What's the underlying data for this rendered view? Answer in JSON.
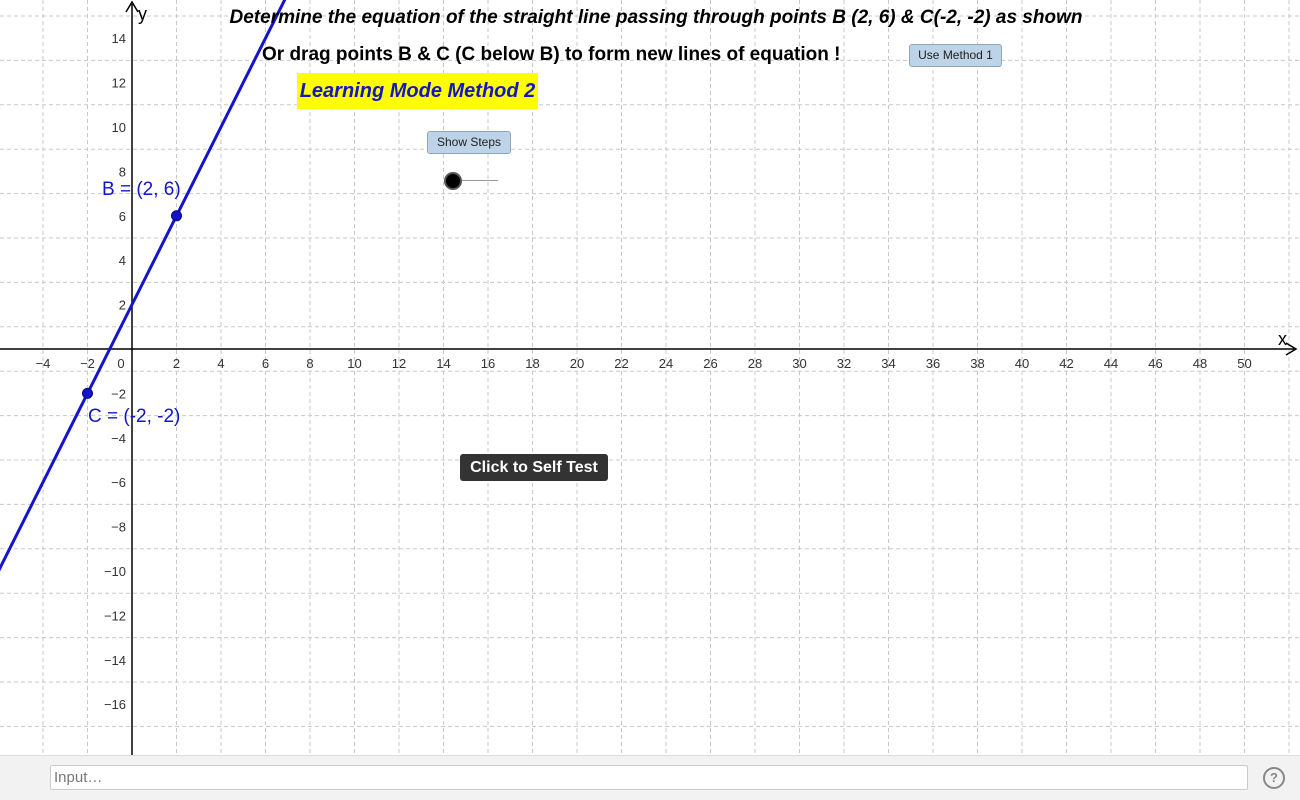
{
  "toolbar": {
    "heading": "Determine the equation of the straight line passing through points B (2, 6) & C(-2, -2) as shown",
    "instruction": "Or drag points B & C  (C below B)  to form new lines of equation !",
    "mode_label": "Learning Mode Method 2",
    "method_button": "Use Method 1",
    "steps_button": "Show Steps",
    "self_test_button": "Click to Self Test"
  },
  "points": {
    "B": {
      "label": "B = (2, 6)",
      "x": 2,
      "y": 6
    },
    "C": {
      "label": "C = (-2, -2)",
      "x": -2,
      "y": -2
    }
  },
  "slider": {
    "value": 0
  },
  "axes": {
    "x_label": "x",
    "y_label": "y",
    "x_ticks": [
      -4,
      -2,
      0,
      2,
      4,
      6,
      8,
      10,
      12,
      14,
      16,
      18,
      20,
      22,
      24,
      26,
      28,
      30,
      32,
      34,
      36,
      38,
      40,
      42,
      44,
      46,
      48,
      50
    ],
    "y_ticks": [
      14,
      12,
      10,
      8,
      6,
      4,
      2,
      -2,
      -4,
      -6,
      -8,
      -10,
      -12,
      -14,
      -16
    ],
    "grid": true
  },
  "input_bar": {
    "placeholder": "Input…"
  },
  "help_icon": {
    "symbol": "?"
  },
  "colors": {
    "line": "#1414c8",
    "highlight": "#ffff00",
    "button": "#bdd3e7",
    "dark_button": "#333333"
  }
}
